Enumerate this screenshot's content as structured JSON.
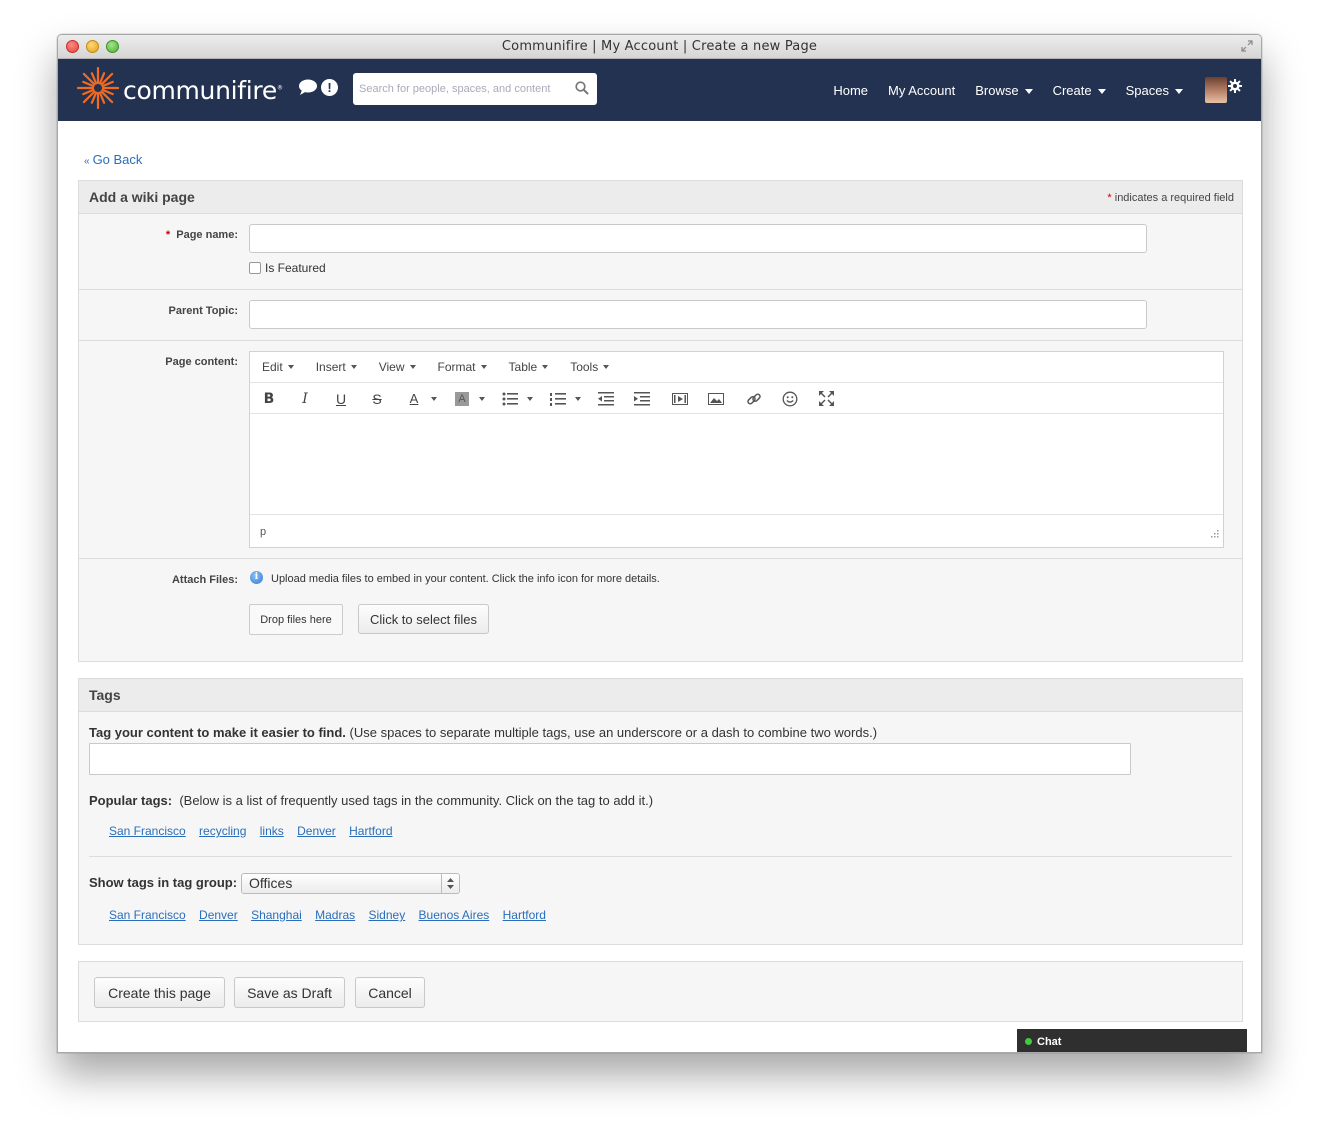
{
  "window": {
    "title": "Communifire | My Account | Create a new Page"
  },
  "navbar": {
    "brand": "communifire",
    "brand_reg": "®",
    "search_placeholder": "Search for people, spaces, and content",
    "links": {
      "home": "Home",
      "my_account": "My Account",
      "browse": "Browse",
      "create": "Create",
      "spaces": "Spaces"
    },
    "colors": {
      "background": "#243251",
      "logo_accent": "#f26b21"
    }
  },
  "page": {
    "go_back": "Go Back",
    "go_back_prefix": "«"
  },
  "form": {
    "title": "Add a wiki page",
    "required_star": "*",
    "required_note": "indicates a required field",
    "page_name_label": "Page name:",
    "page_name_value": "",
    "is_featured_label": "Is Featured",
    "is_featured_checked": false,
    "parent_topic_label": "Parent Topic:",
    "parent_topic_value": "",
    "page_content_label": "Page content:",
    "editor": {
      "menus": [
        "Edit",
        "Insert",
        "View",
        "Format",
        "Table",
        "Tools"
      ],
      "statusbar_path": "p"
    },
    "attach_label": "Attach Files:",
    "attach_info": "Upload media files to embed in your content. Click the info icon for more details.",
    "drop_label": "Drop files here",
    "select_files_label": "Click to select files"
  },
  "tags": {
    "title": "Tags",
    "instruction_bold": "Tag your content to make it easier to find.",
    "instruction_rest": "(Use spaces to separate multiple tags, use an underscore or a dash to combine two words.)",
    "tag_input_value": "",
    "popular_label": "Popular tags:",
    "popular_desc": "(Below is a list of frequently used tags in the community. Click on the tag to add it.)",
    "popular": [
      "San Francisco",
      "recycling",
      "links",
      "Denver",
      "Hartford"
    ],
    "group_label": "Show tags in tag group:",
    "group_selected": "Offices",
    "group_tags": [
      "San Francisco",
      "Denver",
      "Shanghai",
      "Madras",
      "Sidney",
      "Buenos Aires",
      "Hartford"
    ]
  },
  "actions": {
    "create": "Create this page",
    "draft": "Save as Draft",
    "cancel": "Cancel"
  },
  "chat": {
    "label": "Chat",
    "status_color": "#3ecb3e"
  }
}
